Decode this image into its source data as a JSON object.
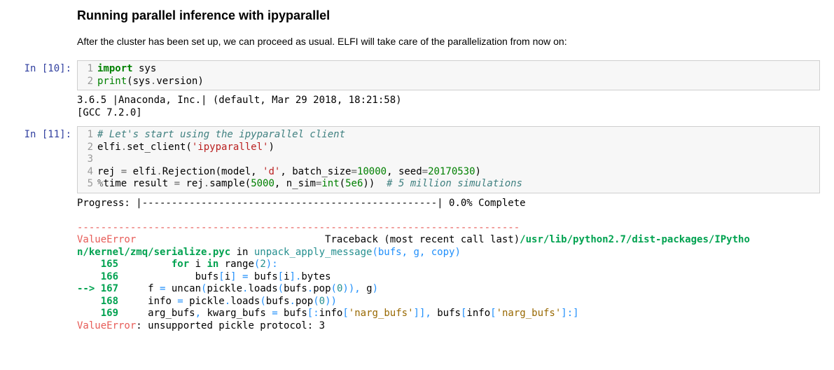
{
  "heading": "Running parallel inference with ipyparallel",
  "intro": "After the cluster has been set up, we can proceed as usual. ELFI will take care of the parallelization from now on:",
  "cells": [
    {
      "prompt": "In [10]:",
      "lines": [
        {
          "n": "1",
          "html": "<span class='c-kw'>import</span> sys"
        },
        {
          "n": "2",
          "html": "<span class='c-bi'>print</span>(sys<span class='c-op'>.</span>version)"
        }
      ],
      "output_html": "3.6.5 |Anaconda, Inc.| (default, Mar 29 2018, 18:21:58) \n[GCC 7.2.0]"
    },
    {
      "prompt": "In [11]:",
      "lines": [
        {
          "n": "1",
          "html": "<span class='c-cm'># Let's start using the ipyparallel client</span>"
        },
        {
          "n": "2",
          "html": "elfi<span class='c-op'>.</span>set_client(<span class='c-str'>'ipyparallel'</span>)"
        },
        {
          "n": "3",
          "html": ""
        },
        {
          "n": "4",
          "html": "rej <span class='c-op'>=</span> elfi<span class='c-op'>.</span>Rejection(model, <span class='c-str'>'d'</span>, batch_size<span class='c-op'>=</span><span class='c-num'>10000</span>, seed<span class='c-op'>=</span><span class='c-num'>20170530</span>)"
        },
        {
          "n": "5",
          "html": "<span class='c-op'>%</span>time result <span class='c-op'>=</span> rej<span class='c-op'>.</span>sample(<span class='c-num'>5000</span>, n_sim<span class='c-op'>=</span><span class='c-bi'>int</span>(<span class='c-num'>5e6</span>))  <span class='c-cm'># 5 million simulations</span>"
        }
      ],
      "output_html": "Progress: |--------------------------------------------------| 0.0% Complete\n\n<span class='t-red'>---------------------------------------------------------------------------</span>\n<span class='t-red'>ValueError</span>                                Traceback (most recent call last)<span class='t-green'>/usr/lib/python2.7/dist-packages/IPytho</span>\n<span class='t-green'>n/kernel/zmq/serialize.pyc</span> in <span class='t-cyan'>unpack_apply_message</span><span class='t-blue'>(bufs, g, copy)</span>\n<span class='t-green'>    165 </span>        <span class='t-green'>for</span> i <span class='t-green'>in</span> range<span class='t-blue'>(</span><span class='t-cyan'>2</span><span class='t-blue'>):</span>\n<span class='t-green'>    166 </span>            bufs<span class='t-blue'>[</span>i<span class='t-blue'>]</span> <span class='t-blue'>=</span> bufs<span class='t-blue'>[</span>i<span class='t-blue'>].</span>bytes\n<span class='t-green'>--&gt; 167 </span>    f <span class='t-blue'>=</span> uncan<span class='t-blue'>(</span>pickle<span class='t-blue'>.</span>loads<span class='t-blue'>(</span>bufs<span class='t-blue'>.</span>pop<span class='t-blue'>(</span><span class='t-cyan'>0</span><span class='t-blue'>)),</span> g<span class='t-blue'>)</span>\n<span class='t-green'>    168 </span>    info <span class='t-blue'>=</span> pickle<span class='t-blue'>.</span>loads<span class='t-blue'>(</span>bufs<span class='t-blue'>.</span>pop<span class='t-blue'>(</span><span class='t-cyan'>0</span><span class='t-blue'>))</span>\n<span class='t-green'>    169 </span>    arg_bufs<span class='t-blue'>,</span> kwarg_bufs <span class='t-blue'>=</span> bufs<span class='t-blue'>[:</span>info<span class='t-blue'>[</span><span class='t-yellow'>'narg_bufs'</span><span class='t-blue'>]],</span> bufs<span class='t-blue'>[</span>info<span class='t-blue'>[</span><span class='t-yellow'>'narg_bufs'</span><span class='t-blue'>]:]</span>\n<span class='t-red'>ValueError</span>: unsupported pickle protocol: 3"
    }
  ]
}
